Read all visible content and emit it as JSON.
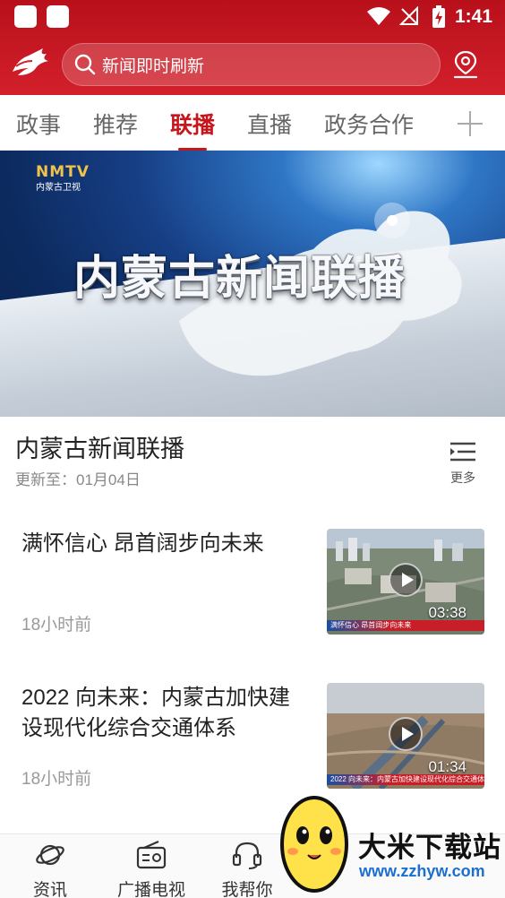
{
  "status_bar": {
    "time": "1:41"
  },
  "header": {
    "search_placeholder": "新闻即时刷新",
    "accent_color": "#c4161c"
  },
  "tabs": [
    {
      "label": "政事",
      "active": false
    },
    {
      "label": "推荐",
      "active": false
    },
    {
      "label": "联播",
      "active": true
    },
    {
      "label": "直播",
      "active": false
    },
    {
      "label": "政务合作",
      "active": false
    }
  ],
  "banner": {
    "channel_logo": "NMTV",
    "channel_name": "内蒙古卫视",
    "title": "内蒙古新闻联播"
  },
  "program": {
    "title": "内蒙古新闻联播",
    "update": "更新至：01月04日",
    "more_label": "更多"
  },
  "news": [
    {
      "title": "满怀信心 昂首阔步向未来",
      "time": "18小时前",
      "duration": "03:38",
      "thumb_caption": "满怀信心 昂首阔步向未来"
    },
    {
      "title": "2022 向未来：内蒙古加快建设现代化综合交通体系",
      "time": "18小时前",
      "duration": "01:34",
      "thumb_caption": "2022 向未来：内蒙古加快建设现代化综合交通体系"
    }
  ],
  "bottom_nav": [
    {
      "label": "资讯",
      "icon": "planet-icon",
      "active": false
    },
    {
      "label": "广播电视",
      "icon": "radio-icon",
      "active": false
    },
    {
      "label": "我帮你",
      "icon": "headset-icon",
      "active": false
    }
  ],
  "watermark": {
    "title": "大米下载站",
    "url": "www.zzhyw.com"
  }
}
